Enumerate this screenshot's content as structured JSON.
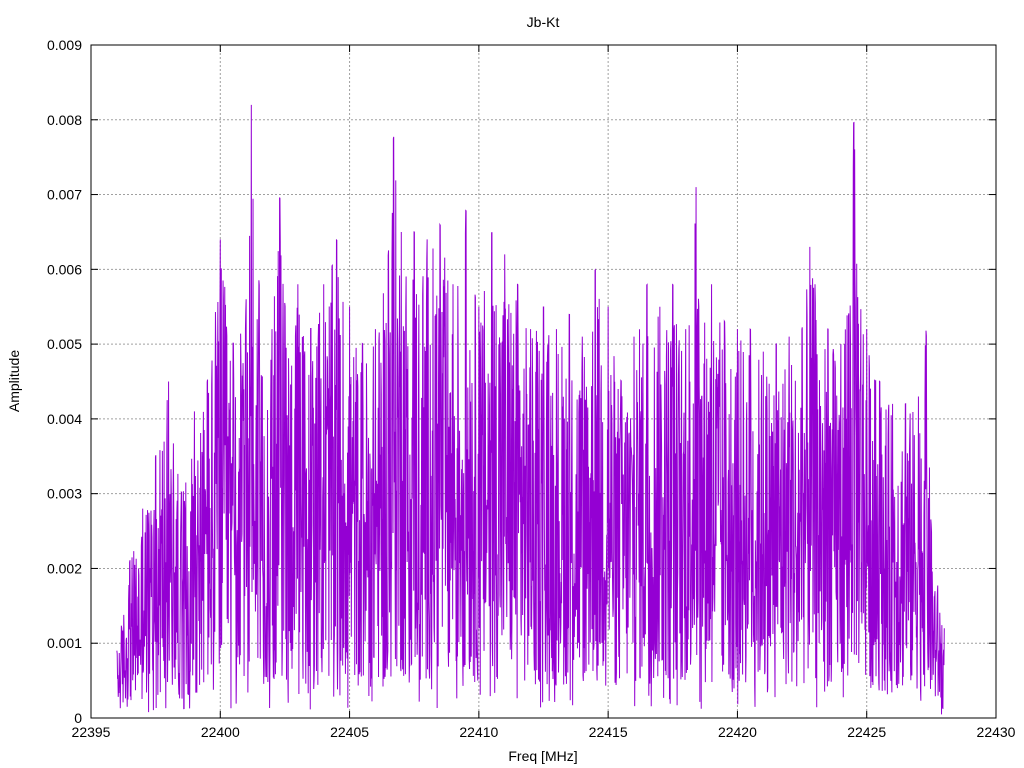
{
  "chart_data": {
    "type": "line",
    "title": "Jb-Kt",
    "xlabel": "Freq [MHz]",
    "ylabel": "Amplitude",
    "xlim": [
      22395,
      22430
    ],
    "ylim": [
      0,
      0.009
    ],
    "x_ticks": [
      22395,
      22400,
      22405,
      22410,
      22415,
      22420,
      22425,
      22430
    ],
    "y_ticks": [
      0,
      0.001,
      0.002,
      0.003,
      0.004,
      0.005,
      0.006,
      0.007,
      0.008,
      0.009
    ],
    "x_tick_labels": [
      "22395",
      "22400",
      "22405",
      "22410",
      "22415",
      "22420",
      "22425",
      "22430"
    ],
    "y_tick_labels": [
      "0",
      "0.001",
      "0.002",
      "0.003",
      "0.004",
      "0.005",
      "0.006",
      "0.007",
      "0.008",
      "0.009"
    ],
    "grid": true,
    "line_color": "#9400d3",
    "series": [
      {
        "x": [
          22396.0,
          22396.5,
          22397.0,
          22397.5,
          22398.0,
          22398.5,
          22399.0,
          22399.5,
          22400.0,
          22400.5,
          22401.0,
          22401.2,
          22401.5,
          22402.0,
          22402.3,
          22402.5,
          22403.0,
          22403.5,
          22404.0,
          22404.5,
          22405.0,
          22405.5,
          22406.0,
          22406.5,
          22406.7,
          22407.0,
          22407.5,
          22408.0,
          22408.5,
          22409.0,
          22409.5,
          22410.0,
          22410.5,
          22411.0,
          22411.5,
          22412.0,
          22412.5,
          22413.0,
          22413.5,
          22414.0,
          22414.5,
          22415.0,
          22415.5,
          22416.0,
          22416.5,
          22417.0,
          22417.5,
          22418.0,
          22418.4,
          22418.5,
          22419.0,
          22419.5,
          22420.0,
          22420.5,
          22421.0,
          22421.5,
          22422.0,
          22422.5,
          22422.8,
          22423.0,
          22423.5,
          22424.0,
          22424.5,
          22425.0,
          22425.5,
          22426.0,
          22426.5,
          22427.0,
          22427.3,
          22427.5,
          22428.0
        ],
        "y": [
          0.0009,
          0.0021,
          0.0028,
          0.0035,
          0.0045,
          0.003,
          0.0041,
          0.0045,
          0.0064,
          0.005,
          0.0056,
          0.0082,
          0.0058,
          0.0052,
          0.007,
          0.0055,
          0.0058,
          0.0052,
          0.0058,
          0.0064,
          0.0055,
          0.005,
          0.0052,
          0.0062,
          0.0078,
          0.0065,
          0.0065,
          0.0064,
          0.0066,
          0.0058,
          0.0068,
          0.0055,
          0.0065,
          0.0062,
          0.0058,
          0.0052,
          0.0055,
          0.0052,
          0.0054,
          0.0051,
          0.006,
          0.0055,
          0.0045,
          0.0051,
          0.0058,
          0.0055,
          0.0058,
          0.0052,
          0.0071,
          0.0055,
          0.0058,
          0.0053,
          0.0052,
          0.0052,
          0.0049,
          0.005,
          0.0051,
          0.0052,
          0.0063,
          0.0058,
          0.0052,
          0.005,
          0.008,
          0.0052,
          0.0045,
          0.0042,
          0.0042,
          0.0043,
          0.0052,
          0.0025,
          0.0012
        ]
      }
    ]
  }
}
